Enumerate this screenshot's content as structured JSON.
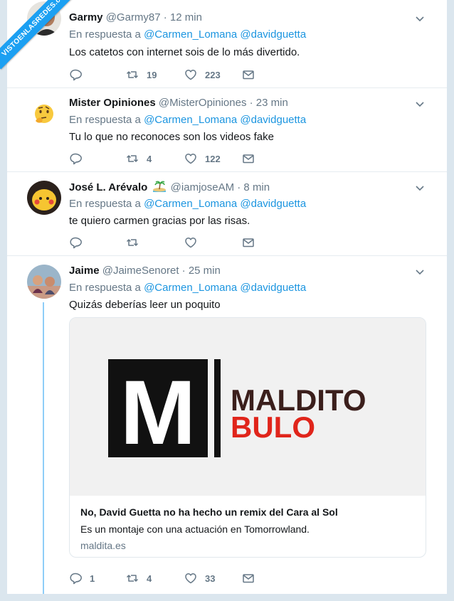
{
  "brand": {
    "ribbon": "VISTOENLASREDES.com"
  },
  "tweets": [
    {
      "name": "Garmy",
      "handle": "@Garmy87",
      "time": "· 12 min",
      "reply_prefix": "En respuesta a",
      "mention1": "@Carmen_Lomana",
      "mention2": "@davidguetta",
      "text": "Los catetos con internet sois de lo más divertido.",
      "retweets": "19",
      "likes": "223"
    },
    {
      "name": "Mister Opiniones",
      "handle": "@MisterOpiniones",
      "time": "· 23 min",
      "reply_prefix": "En respuesta a",
      "mention1": "@Carmen_Lomana",
      "mention2": "@davidguetta",
      "text": "Tu lo que no reconoces son los videos fake",
      "retweets": "4",
      "likes": "122"
    },
    {
      "name": "José L. Arévalo",
      "handle": "@iamjoseAM",
      "time": "· 8 min",
      "reply_prefix": "En respuesta a",
      "mention1": "@Carmen_Lomana",
      "mention2": "@davidguetta",
      "text": "te quiero carmen gracias por las risas."
    },
    {
      "name": "Jaime",
      "handle": "@JaimeSenoret",
      "time": "· 25 min",
      "reply_prefix": "En respuesta a",
      "mention1": "@Carmen_Lomana",
      "mention2": "@davidguetta",
      "text": "Quizás deberías  leer un poquito",
      "replies": "1",
      "retweets": "4",
      "likes": "33",
      "card": {
        "logo_top": "MALDITO",
        "logo_bottom": "BULO",
        "logo_letter": "M",
        "title": "No, David Guetta no ha hecho un remix del Cara al Sol",
        "description": "Es un montaje con una actuación en Tomorrowland.",
        "domain": "maldita.es",
        "colors": {
          "logo_black": "#111111",
          "logo_dark": "#3b1f1c",
          "logo_red": "#e0251b"
        }
      }
    }
  ],
  "colors": {
    "link": "#1b95e0",
    "muted": "#657786",
    "thread": "#8ecdf8",
    "ribbon": "#1ca0f2"
  }
}
